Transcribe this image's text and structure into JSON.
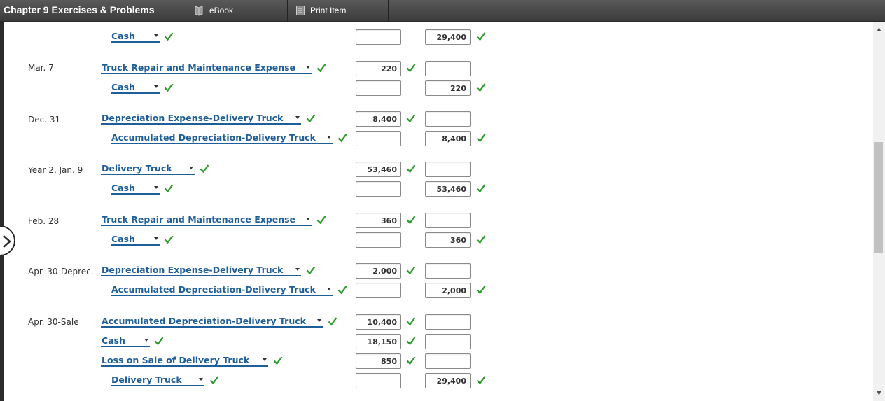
{
  "header": {
    "title": "Chapter 9 Exercises & Problems",
    "tabs": [
      {
        "label": "eBook",
        "icon": "book-icon"
      },
      {
        "label": "Print Item",
        "icon": "document-icon"
      }
    ]
  },
  "colors": {
    "accent": "#1f5f99",
    "check": "#2e9c2e",
    "topbar": "#4a4a4a"
  },
  "rows": [
    {
      "date": "",
      "account": "Cash",
      "debit": "",
      "credit": "29,400"
    },
    {
      "date": "Mar. 7",
      "account": "Truck Repair and Maintenance Expense",
      "debit": "220",
      "credit": ""
    },
    {
      "date": "",
      "account": "Cash",
      "debit": "",
      "credit": "220"
    },
    {
      "date": "Dec. 31",
      "account": "Depreciation Expense-Delivery Truck",
      "debit": "8,400",
      "credit": ""
    },
    {
      "date": "",
      "account": "Accumulated Depreciation-Delivery Truck",
      "debit": "",
      "credit": "8,400"
    },
    {
      "date": "Year 2, Jan. 9",
      "account": "Delivery Truck",
      "debit": "53,460",
      "credit": ""
    },
    {
      "date": "",
      "account": "Cash",
      "debit": "",
      "credit": "53,460"
    },
    {
      "date": "Feb. 28",
      "account": "Truck Repair and Maintenance Expense",
      "debit": "360",
      "credit": ""
    },
    {
      "date": "",
      "account": "Cash",
      "debit": "",
      "credit": "360"
    },
    {
      "date": "Apr. 30-Deprec.",
      "account": "Depreciation Expense-Delivery Truck",
      "debit": "2,000",
      "credit": ""
    },
    {
      "date": "",
      "account": "Accumulated Depreciation-Delivery Truck",
      "debit": "",
      "credit": "2,000"
    },
    {
      "date": "Apr. 30-Sale",
      "account": "Accumulated Depreciation-Delivery Truck",
      "debit": "10,400",
      "credit": ""
    },
    {
      "date": "",
      "account": "Cash",
      "debit": "18,150",
      "credit": ""
    },
    {
      "date": "",
      "account": "Loss on Sale of Delivery Truck",
      "debit": "850",
      "credit": ""
    },
    {
      "date": "",
      "account": "Delivery Truck",
      "debit": "",
      "credit": "29,400"
    }
  ]
}
